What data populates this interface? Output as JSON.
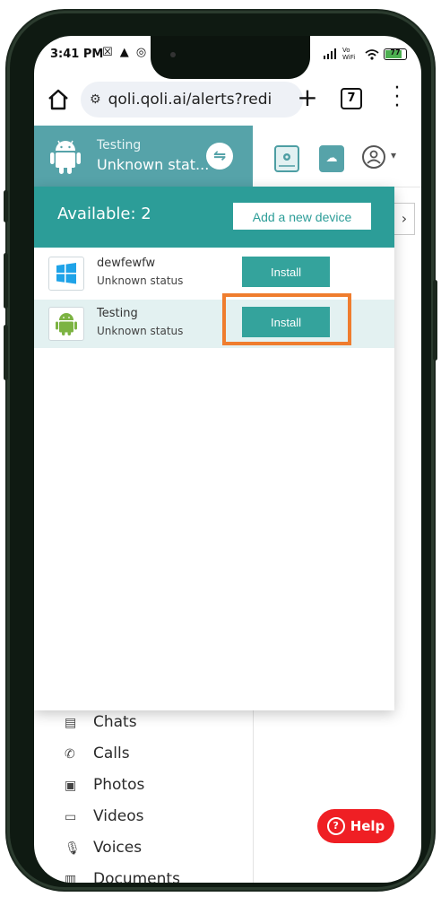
{
  "status_bar": {
    "time": "3:41 PM",
    "left_icons": "☒ ▲ ◎",
    "right_text": "Vo WiFi",
    "battery_level": 0.77,
    "battery_label": "77"
  },
  "browser": {
    "url": "qoli.qoli.ai/alerts?redi",
    "tab_count": "7"
  },
  "header": {
    "device_name": "Testing",
    "device_status": "Unknown stat..."
  },
  "dropdown": {
    "available_label": "Available: 2",
    "add_device_label": "Add a new device",
    "devices": [
      {
        "name": "dewfewfw",
        "status": "Unknown status",
        "os": "windows",
        "button": "Install"
      },
      {
        "name": "Testing",
        "status": "Unknown status",
        "os": "android",
        "button": "Install"
      }
    ]
  },
  "sidebar": {
    "items": [
      {
        "label": "Chats",
        "icon": "chat-icon"
      },
      {
        "label": "Calls",
        "icon": "whatsapp-icon"
      },
      {
        "label": "Photos",
        "icon": "photo-icon"
      },
      {
        "label": "Videos",
        "icon": "video-icon"
      },
      {
        "label": "Voices",
        "icon": "mic-icon"
      },
      {
        "label": "Documents",
        "icon": "document-icon"
      }
    ]
  },
  "help": {
    "label": "Help"
  },
  "colors": {
    "teal": "#2c9d98",
    "teal_light": "#56a3a9",
    "highlight": "#ef7d2e",
    "help_red": "#ef1f24"
  }
}
